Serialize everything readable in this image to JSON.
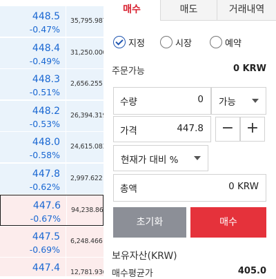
{
  "orderbook": {
    "rows": [
      {
        "price": "448.5",
        "pct": "-0.47%",
        "vol": "35,795.987",
        "side": "ask"
      },
      {
        "price": "448.4",
        "pct": "-0.49%",
        "vol": "31,250.000",
        "side": "ask"
      },
      {
        "price": "448.3",
        "pct": "-0.51%",
        "vol": "2,656.255",
        "side": "ask"
      },
      {
        "price": "448.2",
        "pct": "-0.53%",
        "vol": "26,394.319",
        "side": "ask"
      },
      {
        "price": "448.0",
        "pct": "-0.58%",
        "vol": "24,615.083",
        "side": "ask"
      },
      {
        "price": "447.8",
        "pct": "-0.62%",
        "vol": "2,997.622",
        "side": "ask"
      },
      {
        "price": "447.6",
        "pct": "-0.67%",
        "vol": "94,238.862",
        "side": "bid",
        "current": true
      },
      {
        "price": "447.5",
        "pct": "-0.69%",
        "vol": "6,248.466",
        "side": "bid"
      },
      {
        "price": "447.4",
        "pct": "-0.71%",
        "vol": "12,781.936",
        "side": "bid"
      }
    ]
  },
  "tabs": {
    "buy": "매수",
    "sell": "매도",
    "history": "거래내역"
  },
  "order_types": {
    "limit": "지정",
    "market": "시장",
    "reserve": "예약"
  },
  "available": {
    "label": "주문가능",
    "value": "0 KRW"
  },
  "quantity": {
    "label": "수량",
    "value": "0",
    "select": "가능"
  },
  "price": {
    "label": "가격",
    "value": "447.8",
    "minus": "−",
    "plus": "+"
  },
  "pct_select": {
    "text": "현재가 대비 %"
  },
  "total": {
    "label": "총액",
    "value": "0 KRW"
  },
  "buttons": {
    "reset": "초기화",
    "buy": "매수"
  },
  "holdings": {
    "title": "보유자산(KRW)",
    "avg_label": "매수평균가",
    "avg_value": "405.0"
  },
  "colors": {
    "ask_bg": "#eaf3fb",
    "bid_bg": "#fcecec",
    "price_blue": "#1967d2",
    "accent_red": "#d81f2e",
    "reset_gray": "#8c8f97",
    "buy_red": "#e5323b"
  }
}
